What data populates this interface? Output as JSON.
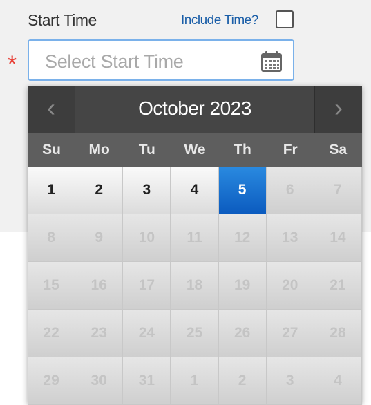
{
  "field": {
    "label": "Start Time",
    "include_time_label": "Include Time?",
    "include_time_checked": false,
    "required_marker": "*",
    "placeholder": "Select Start Time",
    "icon": "calendar-icon"
  },
  "calendar": {
    "prev_glyph": "‹",
    "next_glyph": "›",
    "month_title": "October 2023",
    "weekdays": [
      "Su",
      "Mo",
      "Tu",
      "We",
      "Th",
      "Fr",
      "Sa"
    ],
    "days": [
      {
        "label": "1",
        "state": "enabled"
      },
      {
        "label": "2",
        "state": "enabled"
      },
      {
        "label": "3",
        "state": "enabled"
      },
      {
        "label": "4",
        "state": "enabled"
      },
      {
        "label": "5",
        "state": "selected"
      },
      {
        "label": "6",
        "state": "disabled"
      },
      {
        "label": "7",
        "state": "disabled"
      },
      {
        "label": "8",
        "state": "disabled"
      },
      {
        "label": "9",
        "state": "disabled"
      },
      {
        "label": "10",
        "state": "disabled"
      },
      {
        "label": "11",
        "state": "disabled"
      },
      {
        "label": "12",
        "state": "disabled"
      },
      {
        "label": "13",
        "state": "disabled"
      },
      {
        "label": "14",
        "state": "disabled"
      },
      {
        "label": "15",
        "state": "disabled"
      },
      {
        "label": "16",
        "state": "disabled"
      },
      {
        "label": "17",
        "state": "disabled"
      },
      {
        "label": "18",
        "state": "disabled"
      },
      {
        "label": "19",
        "state": "disabled"
      },
      {
        "label": "20",
        "state": "disabled"
      },
      {
        "label": "21",
        "state": "disabled"
      },
      {
        "label": "22",
        "state": "disabled"
      },
      {
        "label": "23",
        "state": "disabled"
      },
      {
        "label": "24",
        "state": "disabled"
      },
      {
        "label": "25",
        "state": "disabled"
      },
      {
        "label": "26",
        "state": "disabled"
      },
      {
        "label": "27",
        "state": "disabled"
      },
      {
        "label": "28",
        "state": "disabled"
      },
      {
        "label": "29",
        "state": "disabled"
      },
      {
        "label": "30",
        "state": "disabled"
      },
      {
        "label": "31",
        "state": "disabled"
      },
      {
        "label": "1",
        "state": "disabled"
      },
      {
        "label": "2",
        "state": "disabled"
      },
      {
        "label": "3",
        "state": "disabled"
      },
      {
        "label": "4",
        "state": "disabled"
      }
    ]
  },
  "colors": {
    "accent": "#0b5bbf",
    "required": "#e8433a",
    "link": "#1a5ea8",
    "header": "#454545"
  }
}
